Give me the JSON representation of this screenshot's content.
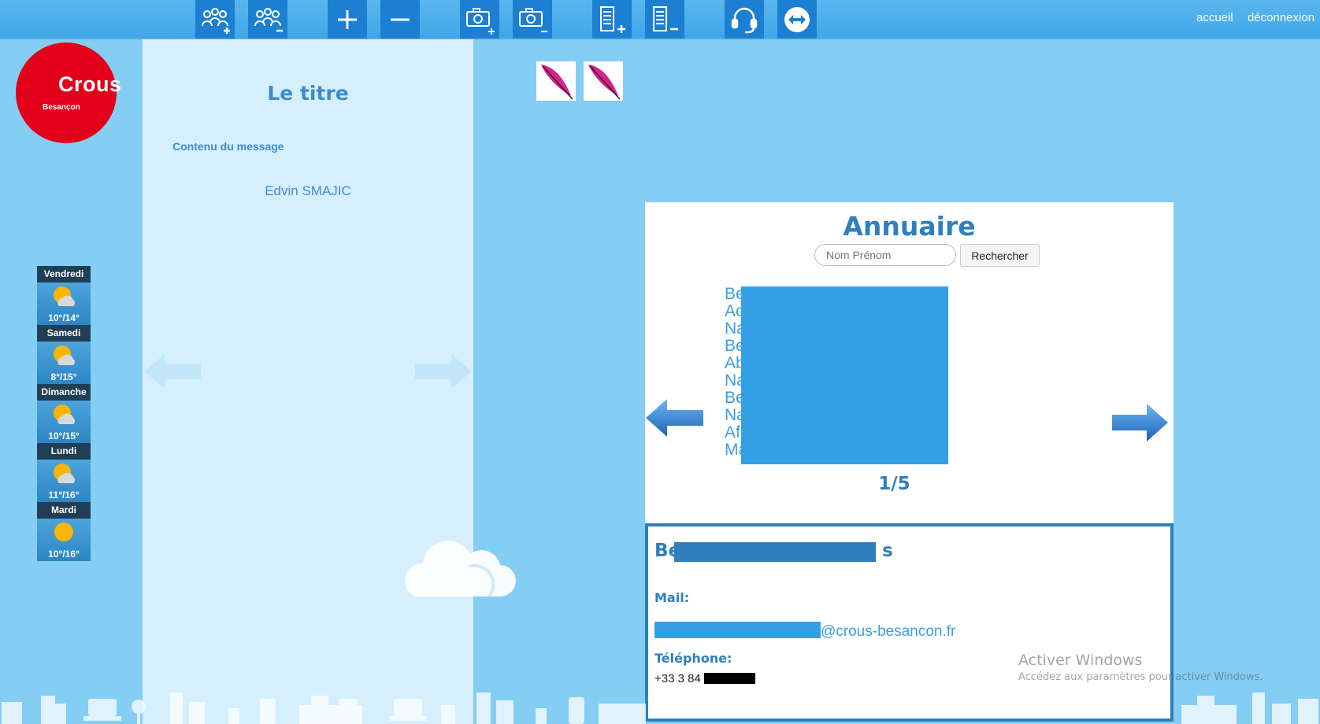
{
  "toolbar": {
    "buttons": [
      {
        "name": "add-group-icon"
      },
      {
        "name": "remove-group-icon"
      },
      {
        "name": "plus-icon"
      },
      {
        "name": "minus-icon"
      },
      {
        "name": "camera-add-icon"
      },
      {
        "name": "camera-remove-icon"
      },
      {
        "name": "document-add-icon"
      },
      {
        "name": "document-remove-icon"
      },
      {
        "name": "headset-icon"
      },
      {
        "name": "teamviewer-icon"
      }
    ],
    "links": {
      "home": "accueil",
      "logout": "déconnexion"
    }
  },
  "logo": {
    "main": "Crous",
    "sub": "Besançon",
    "color": "#e3001b"
  },
  "message": {
    "title": "Le titre",
    "content": "Contenu du message",
    "author": "Edvin SMAJIC"
  },
  "weather": [
    {
      "day": "Vendredi",
      "temp": "10°/14°",
      "icon": "sun-cloud-icon"
    },
    {
      "day": "Samedi",
      "temp": "8°/15°",
      "icon": "sun-cloud-icon"
    },
    {
      "day": "Dimanche",
      "temp": "10°/15°",
      "icon": "sun-cloud-icon"
    },
    {
      "day": "Lundi",
      "temp": "11°/16°",
      "icon": "sun-cloud-icon"
    },
    {
      "day": "Mardi",
      "temp": "10°/16°",
      "icon": "sun-icon"
    }
  ],
  "annuaire": {
    "title": "Annuaire",
    "search_placeholder": "Nom Prénom",
    "search_button": "Rechercher",
    "entries": [
      "Be",
      "Ac",
      "Na",
      "Be",
      "Ab",
      "Na",
      "Be",
      "Na",
      "Af",
      "Ma"
    ],
    "page": "1/5"
  },
  "detail": {
    "name_prefix": "Be",
    "name_suffix": "s",
    "mail_label": "Mail:",
    "mail_domain": "@crous-besancon.fr",
    "phone_label": "Téléphone:",
    "phone_prefix": "+33 3 84"
  },
  "watermark": {
    "line1": "Activer Windows",
    "line2": "Accédez aux paramètres pour activer Windows."
  },
  "colors": {
    "background": "#84cdf3",
    "toolbar_button": "#1d7fd1",
    "accent": "#2f7fbf"
  }
}
